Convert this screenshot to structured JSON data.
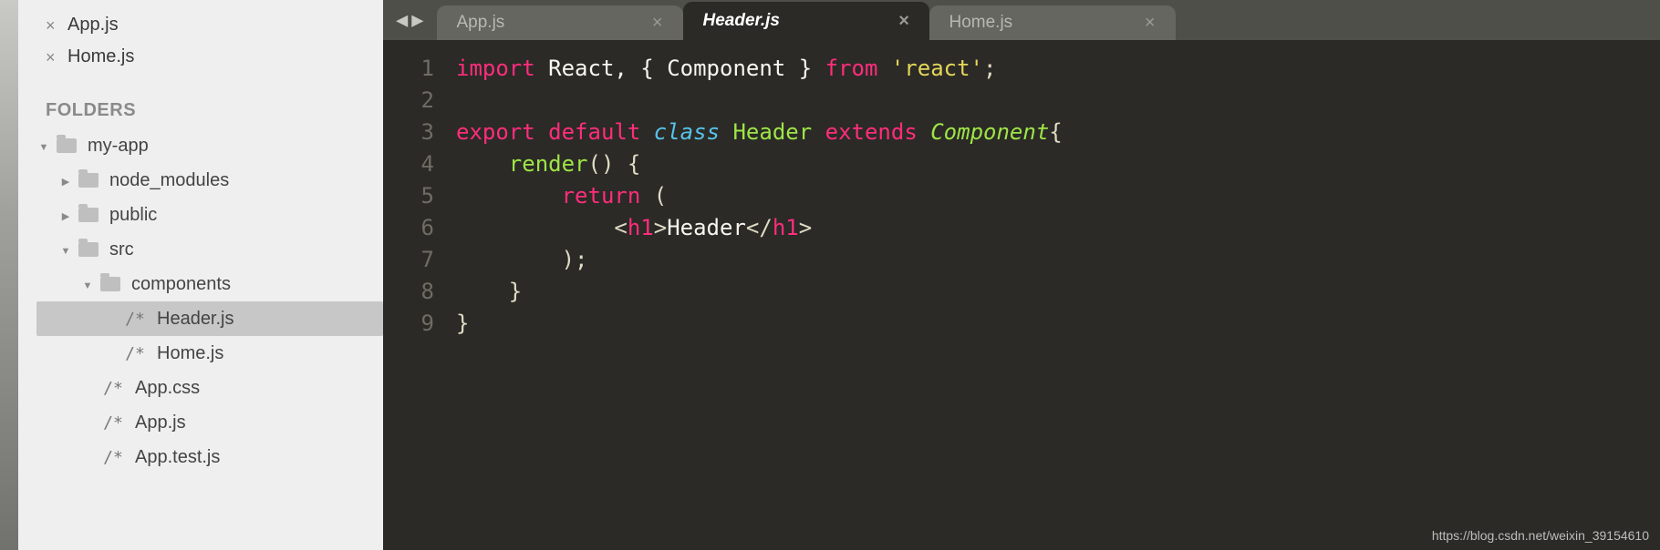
{
  "open_files": [
    {
      "name": "App.js"
    },
    {
      "name": "Home.js"
    }
  ],
  "folders_header": "FOLDERS",
  "tree": {
    "root": "my-app",
    "node_modules": "node_modules",
    "public": "public",
    "src": "src",
    "components": "components",
    "header_js": "Header.js",
    "home_js": "Home.js",
    "app_css": "App.css",
    "app_js": "App.js",
    "app_test_js": "App.test.js"
  },
  "file_glyph": "/*",
  "tabs": [
    {
      "label": "App.js",
      "active": false
    },
    {
      "label": "Header.js",
      "active": true
    },
    {
      "label": "Home.js",
      "active": false
    }
  ],
  "code": {
    "l1": {
      "import": "import",
      "react": "React",
      "comp_open": ", { ",
      "component": "Component",
      "comp_close": " }",
      "from": "from",
      "str": "'react'",
      "semi": ";"
    },
    "l3": {
      "export": "export",
      "default": "default",
      "class": "class",
      "name": "Header",
      "extends": "extends",
      "base": "Component",
      "brace": "{"
    },
    "l4": {
      "render": "render",
      "parens": "()",
      "brace": " {"
    },
    "l5": {
      "return": "return",
      "paren": " ("
    },
    "l6": {
      "lt": "<",
      "tag": "h1",
      "gt": ">",
      "text": "Header",
      "lt2": "</",
      "tag2": "h1",
      "gt2": ">"
    },
    "l7": {
      "close_paren": ");"
    },
    "l8": {
      "brace": "}"
    },
    "l9": {
      "brace": "}"
    }
  },
  "line_numbers": [
    "1",
    "2",
    "3",
    "4",
    "5",
    "6",
    "7",
    "8",
    "9"
  ],
  "watermark": "https://blog.csdn.net/weixin_39154610"
}
